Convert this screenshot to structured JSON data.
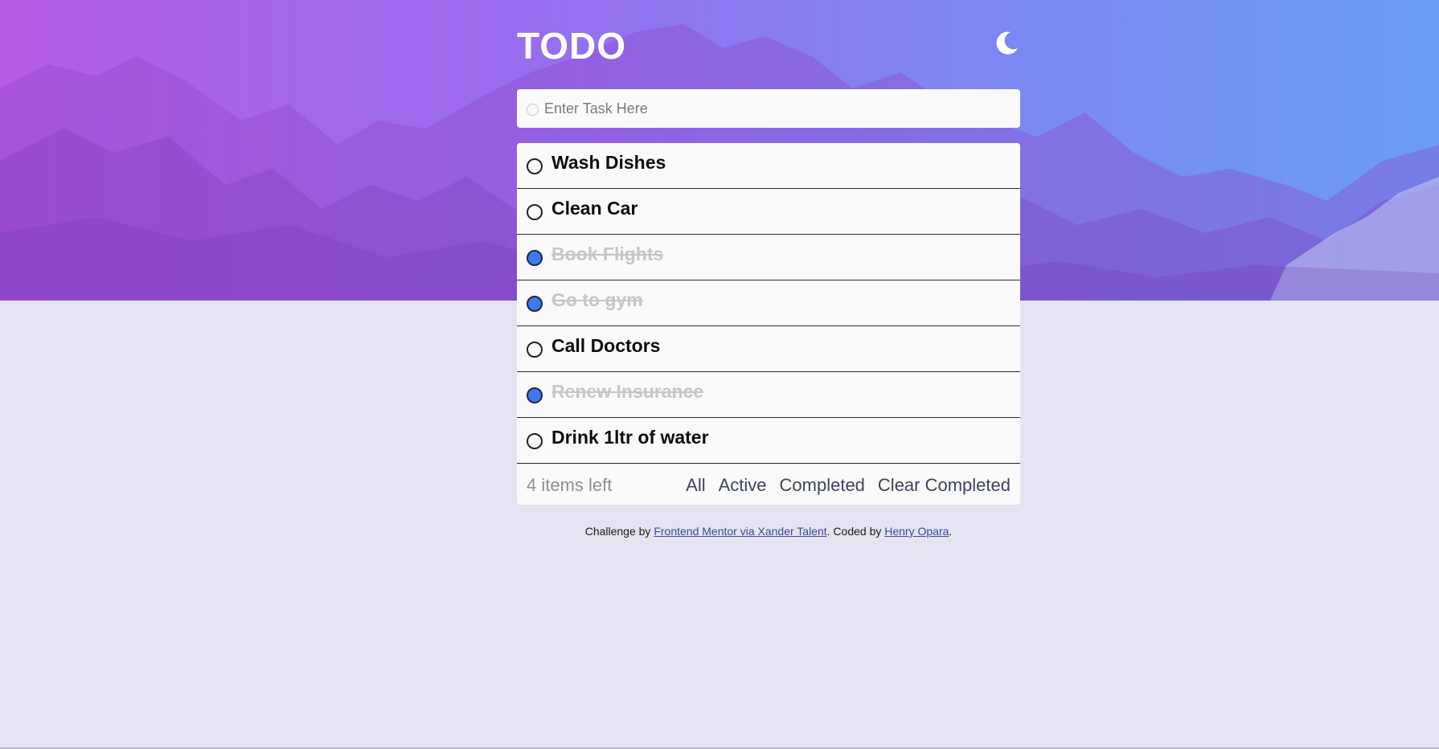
{
  "app": {
    "title": "TODO",
    "theme_toggle_icon": "moon-icon"
  },
  "new_task": {
    "placeholder": "Enter Task Here",
    "value": ""
  },
  "tasks": [
    {
      "label": "Wash Dishes",
      "completed": false
    },
    {
      "label": "Clean Car",
      "completed": false
    },
    {
      "label": "Book Flights",
      "completed": true
    },
    {
      "label": "Go to gym",
      "completed": true
    },
    {
      "label": "Call Doctors",
      "completed": false
    },
    {
      "label": "Renew Insurance",
      "completed": true
    },
    {
      "label": "Drink 1ltr of water",
      "completed": false
    }
  ],
  "footer": {
    "items_left": "4 items left",
    "filters": {
      "all": "All",
      "active": "Active",
      "completed": "Completed",
      "clear": "Clear Completed"
    }
  },
  "attribution": {
    "prefix": "Challenge by ",
    "challenge_link": "Frontend Mentor via Xander Talent",
    "middle": ". Coded by ",
    "author_link": "Henry Opara",
    "suffix": "."
  },
  "colors": {
    "accent": "#3b7bf0",
    "background": "#e4e4f0",
    "card": "#fafafa",
    "hero_gradient_start": "#b35ce8",
    "hero_gradient_end": "#6a9cf6"
  }
}
